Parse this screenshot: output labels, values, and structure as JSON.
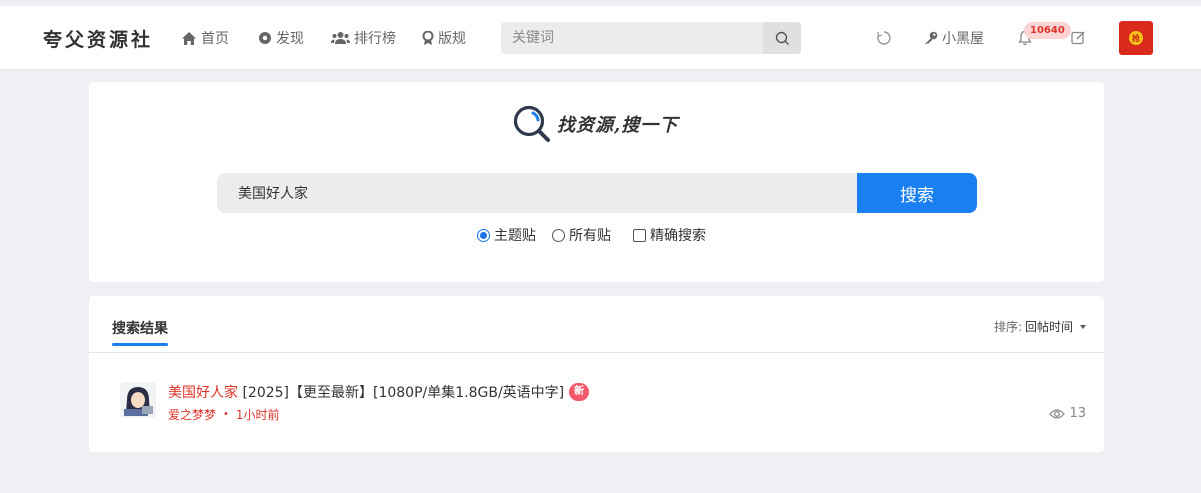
{
  "header": {
    "logo": "夸父资源社",
    "nav": [
      {
        "label": "首页",
        "icon": "home-icon"
      },
      {
        "label": "发现",
        "icon": "compass-icon"
      },
      {
        "label": "排行榜",
        "icon": "users-icon"
      },
      {
        "label": "版规",
        "icon": "badge-icon"
      }
    ],
    "search_placeholder": "关键词",
    "user_link": "小黑屋",
    "notification_count": "10640",
    "red_packet_char": "抢"
  },
  "search_panel": {
    "brand_text": "找资源,搜一下",
    "query": "美国好人家",
    "button_label": "搜索",
    "options": {
      "topic_posts": "主题贴",
      "all_posts": "所有贴",
      "exact": "精确搜索"
    },
    "selected_option": "topic_posts",
    "exact_checked": false
  },
  "results": {
    "tab_label": "搜索结果",
    "sort_label": "排序:",
    "sort_value": "回帖时间",
    "items": [
      {
        "highlight": "美国好人家",
        "title_rest": " [2025]【更至最新】[1080P/单集1.8GB/英语中字]",
        "badge": "新",
        "author": "爱之梦梦",
        "separator": "•",
        "time": "1小时前",
        "views": "13"
      }
    ]
  },
  "colors": {
    "accent": "#1a7ff0",
    "highlight": "#e0342b",
    "background": "#eef0f4"
  }
}
